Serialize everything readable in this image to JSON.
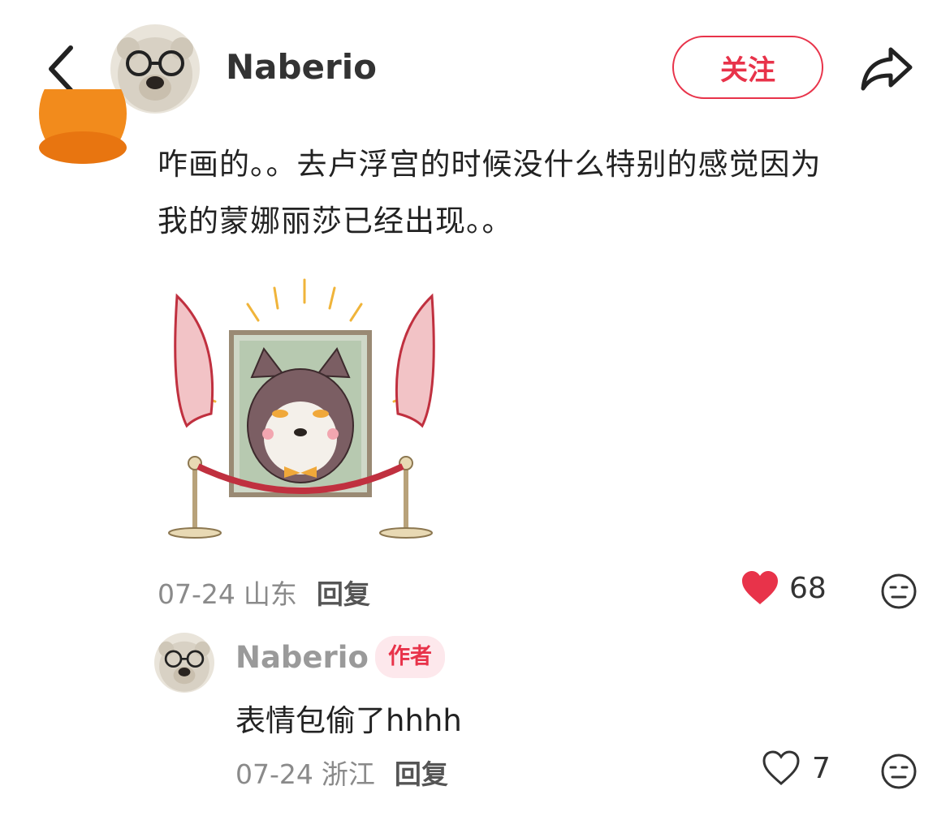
{
  "header": {
    "username": "Naberio",
    "follow_label": "关注",
    "back_icon": "chevron-left-icon",
    "share_icon": "share-arrow-icon"
  },
  "comment": {
    "text_line1": "咋画的。。去卢浮宫的时候没什么特别的感觉因为",
    "text_line2": "我的蒙娜丽莎已经出现。。",
    "sticker": "dog-portrait-sticker",
    "date": "07-24",
    "location": "山东",
    "reply_label": "回复",
    "likes": "68",
    "liked": true
  },
  "reply": {
    "username": "Naberio",
    "badge": "作者",
    "text": "表情包偷了hhhh",
    "date": "07-24",
    "location": "浙江",
    "reply_label": "回复",
    "likes": "7",
    "liked": false
  },
  "colors": {
    "accent": "#e8334a",
    "muted": "#8a8a8a",
    "badge_bg": "#fde8ec"
  }
}
